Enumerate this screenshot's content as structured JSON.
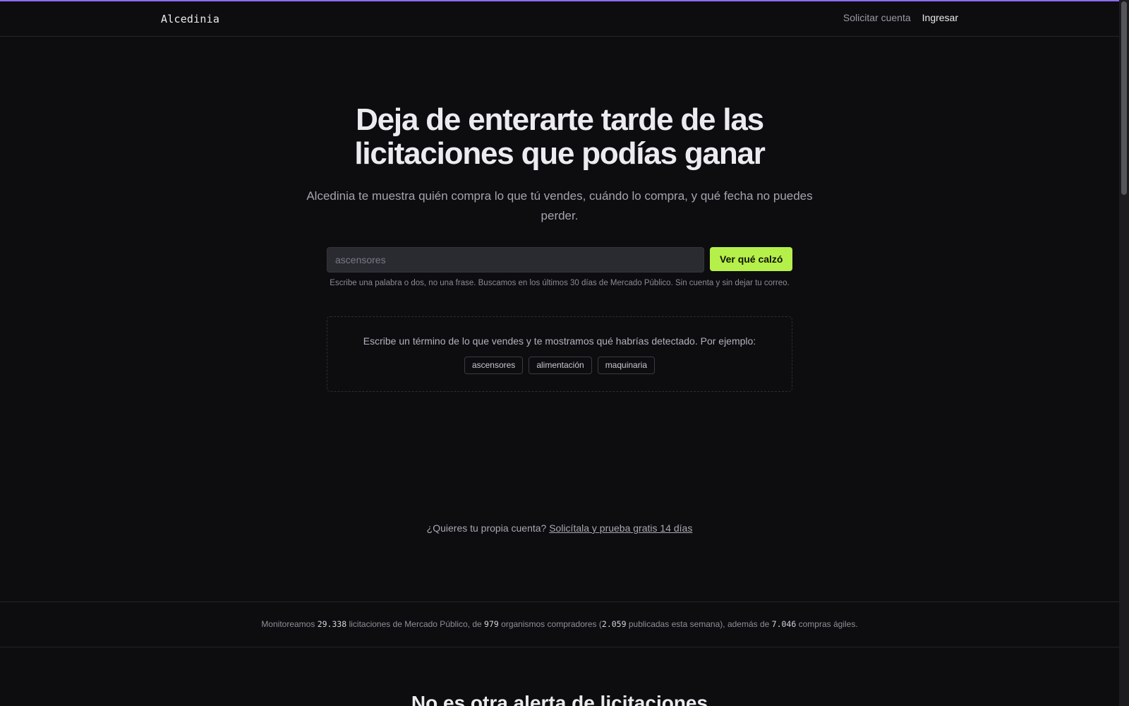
{
  "accent": "#b5f04a",
  "nav": {
    "brand": "Alcedinia",
    "links": [
      {
        "label": "Solicitar cuenta"
      },
      {
        "label": "Ingresar"
      }
    ]
  },
  "hero": {
    "title_line1": "Deja de enterarte tarde de las",
    "title_line2": "licitaciones que podías ganar",
    "subtitle": "Alcedinia te muestra quién compra lo que tú vendes, cuándo lo compra, y qué fecha no puedes perder."
  },
  "search": {
    "placeholder": "ascensores",
    "button_label": "Ver qué calzó",
    "hint": "Escribe una palabra o dos, no una frase. Buscamos en los últimos 30 días de Mercado Público. Sin cuenta y sin dejar tu correo."
  },
  "examples": {
    "intro": "Escribe un término de lo que vendes y te mostramos qué habrías detectado. Por ejemplo:",
    "chips": [
      "ascensores",
      "alimentación",
      "maquinaria"
    ]
  },
  "cta": {
    "text": "¿Quieres tu propia cuenta?",
    "link": "Solicítala y prueba gratis 14 días"
  },
  "stats": {
    "t1": "Monitoreamos",
    "n1": "29.338",
    "t2": "licitaciones de Mercado Público, de",
    "n2": "979",
    "t3": "organismos compradores (",
    "n3": "2.059",
    "t4": "publicadas esta semana), además de",
    "n4": "7.046",
    "t5": "compras ágiles."
  },
  "next_section": {
    "title": "No es otra alerta de licitaciones"
  }
}
